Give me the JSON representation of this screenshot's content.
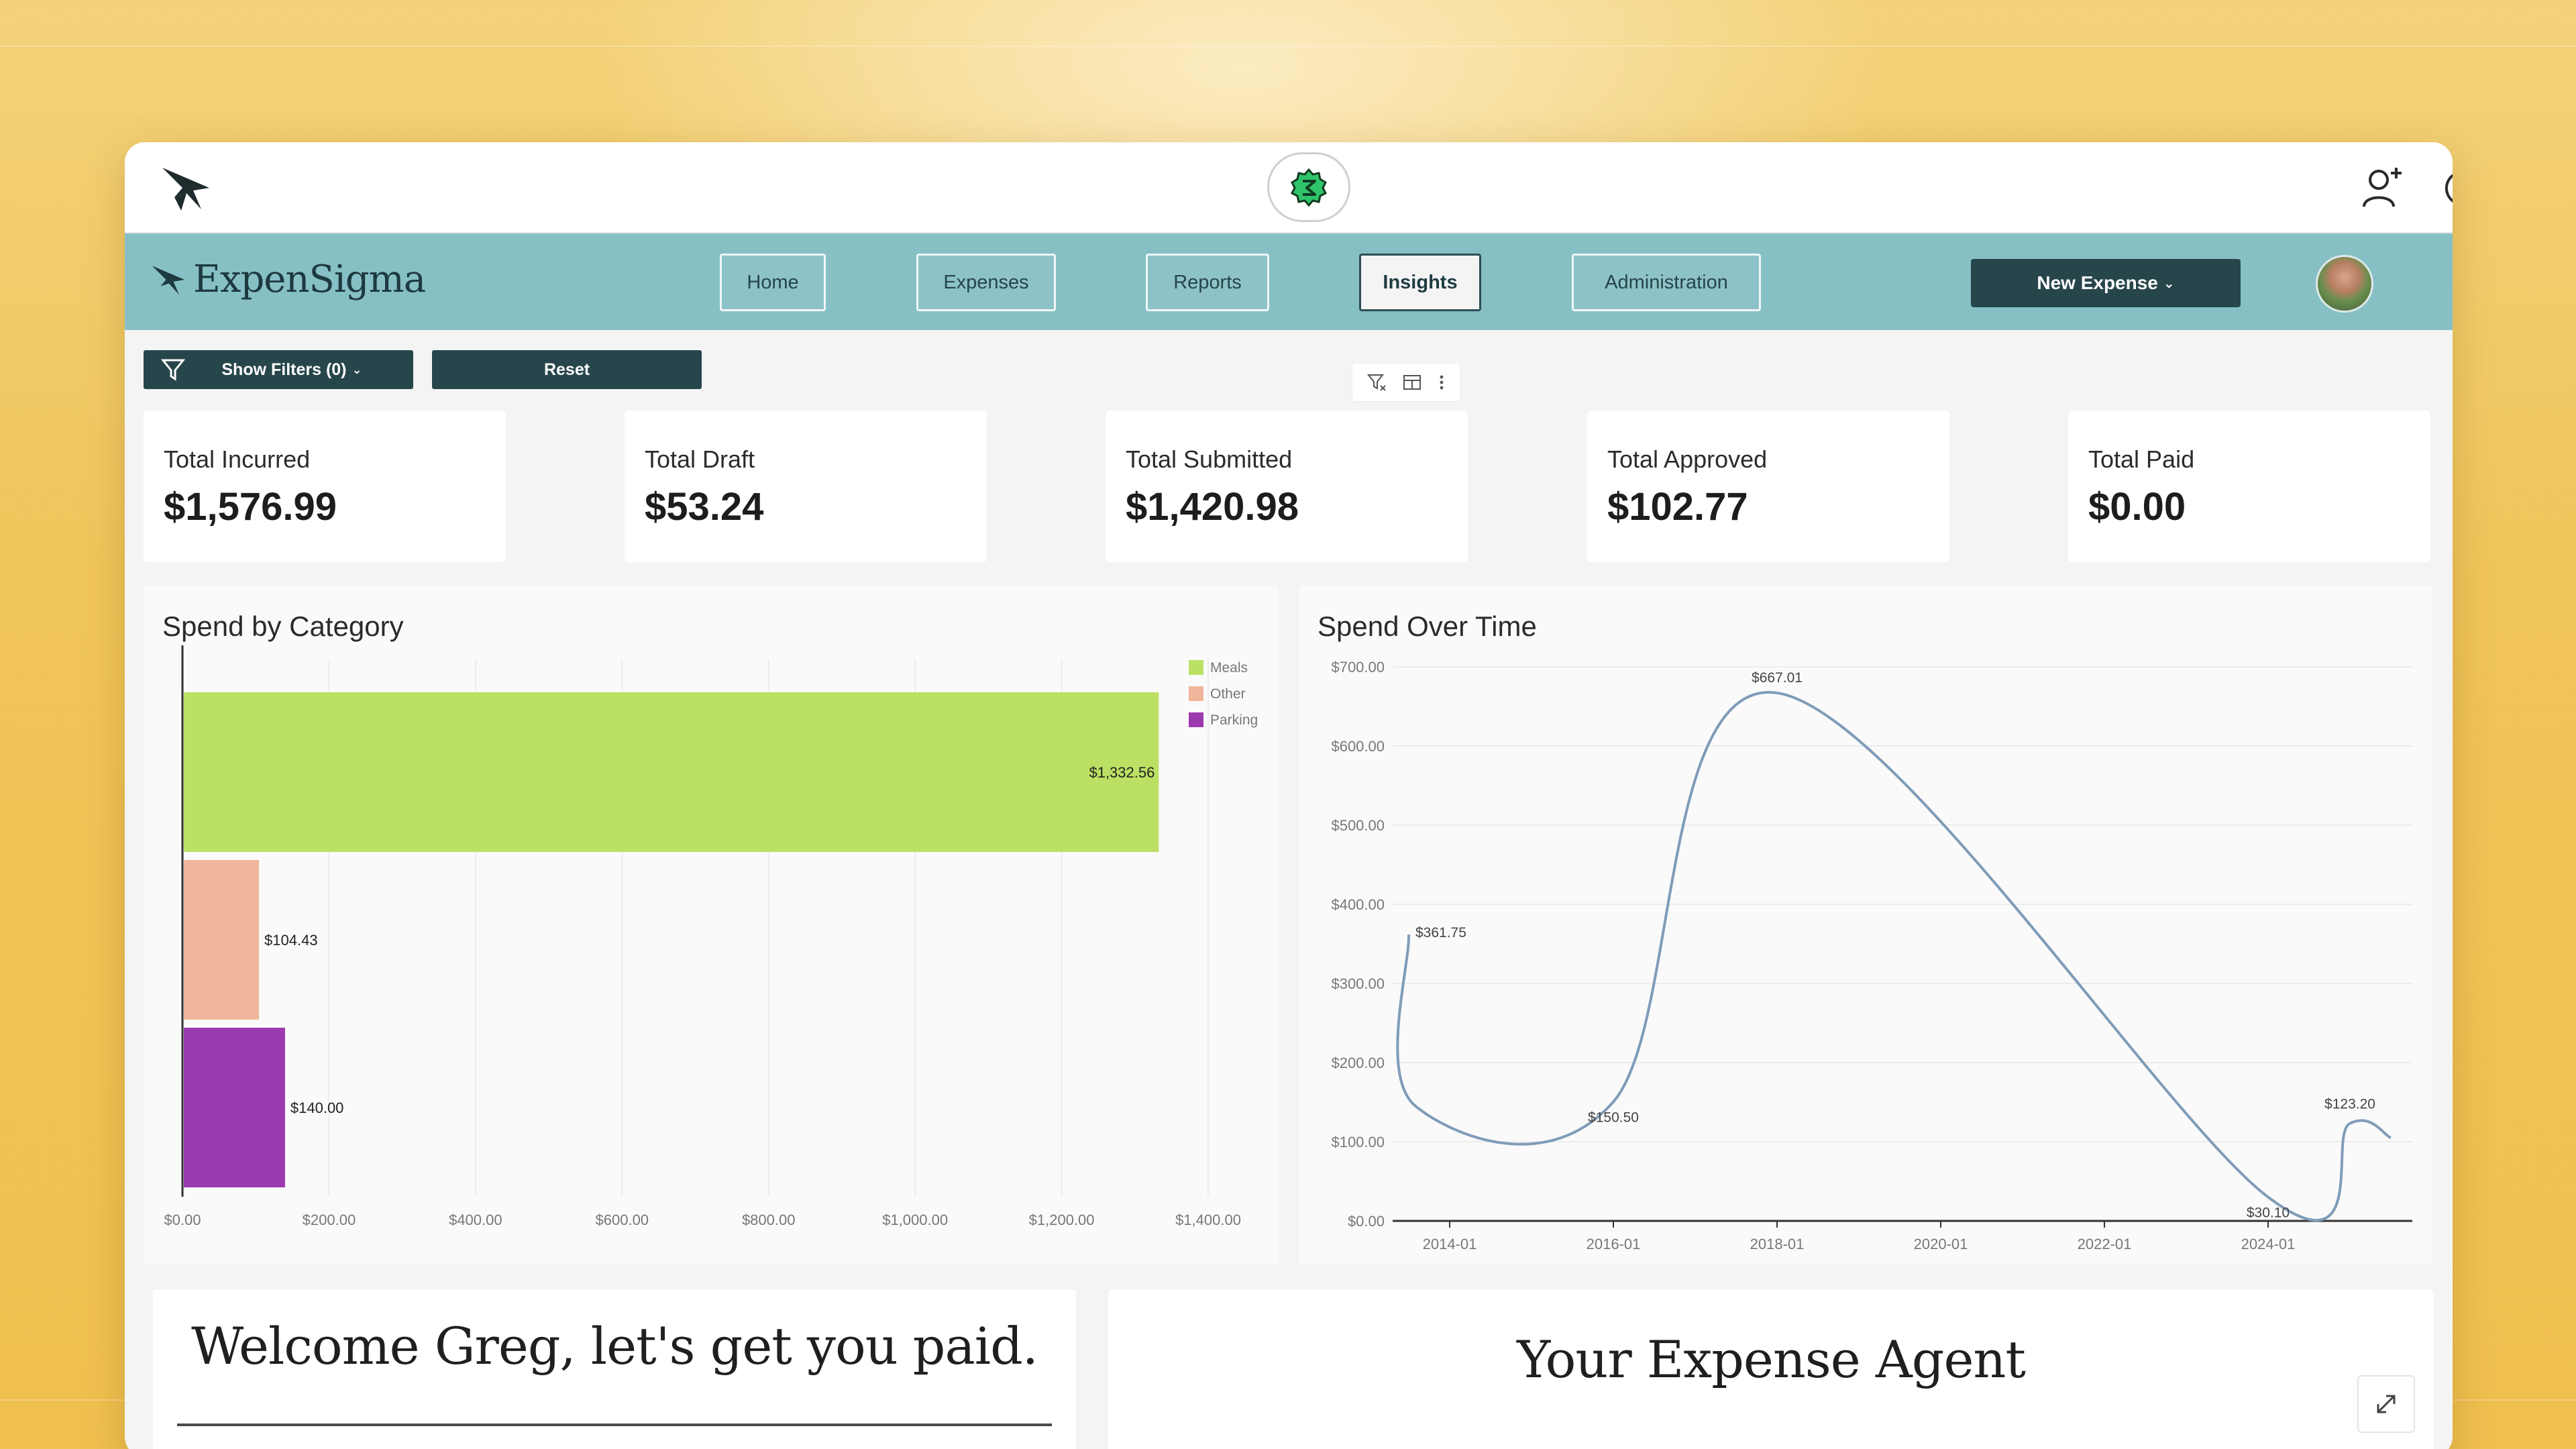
{
  "app": {
    "brand": "ExpenSigma"
  },
  "nav": {
    "items": [
      {
        "label": "Home"
      },
      {
        "label": "Expenses"
      },
      {
        "label": "Reports"
      },
      {
        "label": "Insights",
        "active": true
      },
      {
        "label": "Administration"
      }
    ],
    "new_expense": "New Expense",
    "new_expense_caret": "⌄"
  },
  "filters": {
    "show_filters": "Show Filters (0)",
    "caret": "⌄",
    "reset": "Reset"
  },
  "kpis": [
    {
      "label": "Total Incurred",
      "value": "$1,576.99"
    },
    {
      "label": "Total Draft",
      "value": "$53.24"
    },
    {
      "label": "Total Submitted",
      "value": "$1,420.98"
    },
    {
      "label": "Total Approved",
      "value": "$102.77"
    },
    {
      "label": "Total Paid",
      "value": "$0.00"
    }
  ],
  "charts": {
    "category_title": "Spend by Category",
    "time_title": "Spend Over Time"
  },
  "chart_data": [
    {
      "type": "bar",
      "orientation": "horizontal",
      "title": "Spend by Category",
      "categories": [
        "Meals",
        "Other",
        "Parking"
      ],
      "values": [
        1332.56,
        104.43,
        140.0
      ],
      "value_labels": [
        "$1,332.56",
        "$104.43",
        "$140.00"
      ],
      "colors": [
        "#bce063",
        "#efb69b",
        "#9b3aae"
      ],
      "xlim": [
        0,
        1400
      ],
      "x_ticks": [
        "$0.00",
        "$200.00",
        "$400.00",
        "$600.00",
        "$800.00",
        "$1,000.00",
        "$1,200.00",
        "$1,400.00"
      ],
      "legend": [
        "Meals",
        "Other",
        "Parking"
      ],
      "legend_position": "top-right",
      "grid": true
    },
    {
      "type": "line",
      "title": "Spend Over Time",
      "x": [
        "2013-07",
        "2013-08",
        "2016-01",
        "2018-01",
        "2024-01",
        "2025-01",
        "2025-07"
      ],
      "y": [
        361.75,
        145,
        150.5,
        667.01,
        30.1,
        123.2,
        105
      ],
      "point_labels": [
        {
          "x": "2013-07",
          "label": "$361.75"
        },
        {
          "x": "2016-01",
          "label": "$150.50"
        },
        {
          "x": "2018-01",
          "label": "$667.01"
        },
        {
          "x": "2024-01",
          "label": "$30.10"
        },
        {
          "x": "2025-01",
          "label": "$123.20"
        }
      ],
      "ylim": [
        0,
        700
      ],
      "y_ticks": [
        "$0.00",
        "$100.00",
        "$200.00",
        "$300.00",
        "$400.00",
        "$500.00",
        "$600.00",
        "$700.00"
      ],
      "x_ticks": [
        "2014-01",
        "2016-01",
        "2018-01",
        "2020-01",
        "2022-01",
        "2024-01"
      ],
      "line_color": "#7f9cb8",
      "grid": true
    }
  ],
  "bottom": {
    "welcome": "Welcome Greg, let's get you paid.",
    "agent": "Your Expense Agent"
  },
  "colors": {
    "teal_nav": "#86c0c5",
    "dark_teal": "#27464b",
    "background": "#f0c55a"
  }
}
